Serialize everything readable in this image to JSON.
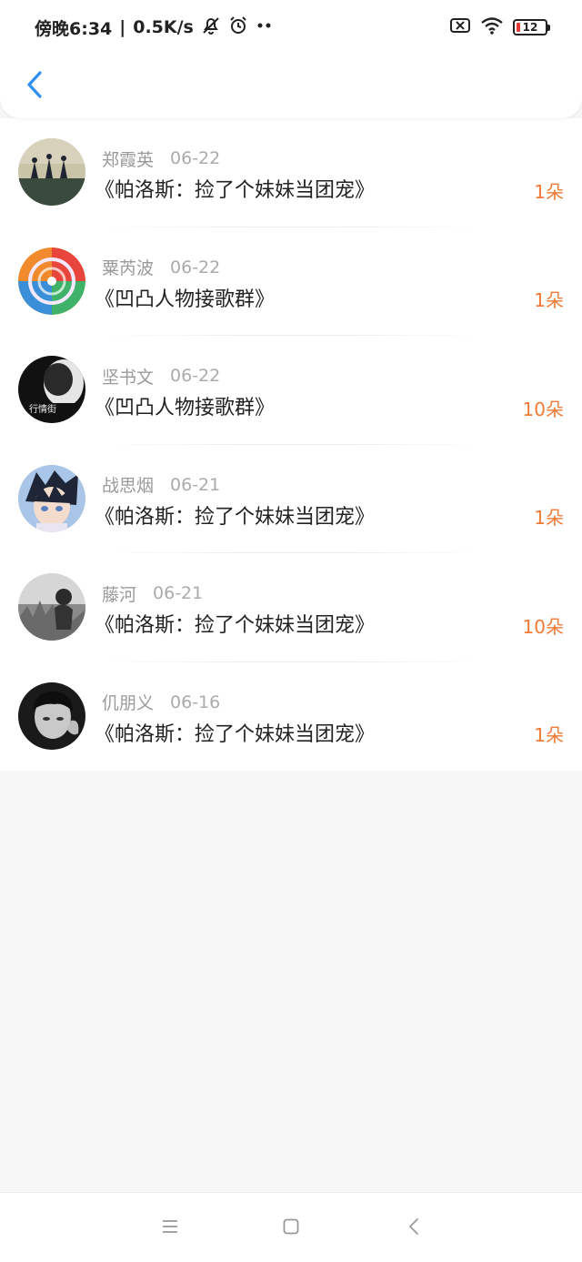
{
  "status_bar": {
    "time": "傍晚6:34",
    "speed": "0.5K/s",
    "battery": "12"
  },
  "colors": {
    "accent": "#2f8ff0",
    "count": "#f07a36"
  },
  "header": {
    "back_icon": "chevron-left-icon"
  },
  "items": [
    {
      "name": "郑霞英",
      "date": "06-22",
      "title": "《帕洛斯：捡了个妹妹当团宠》",
      "count": "1朵"
    },
    {
      "name": "粟芮波",
      "date": "06-22",
      "title": "《凹凸人物接歌群》",
      "count": "1朵"
    },
    {
      "name": "坚书文",
      "date": "06-22",
      "title": "《凹凸人物接歌群》",
      "count": "10朵"
    },
    {
      "name": "战思烟",
      "date": "06-21",
      "title": "《帕洛斯：捡了个妹妹当团宠》",
      "count": "1朵"
    },
    {
      "name": "藤河",
      "date": "06-21",
      "title": "《帕洛斯：捡了个妹妹当团宠》",
      "count": "10朵"
    },
    {
      "name": "仉朋义",
      "date": "06-16",
      "title": "《帕洛斯：捡了个妹妹当团宠》",
      "count": "1朵"
    }
  ],
  "nav": {
    "menu_icon": "menu-icon",
    "home_icon": "home-square-icon",
    "back_icon": "back-triangle-icon"
  }
}
